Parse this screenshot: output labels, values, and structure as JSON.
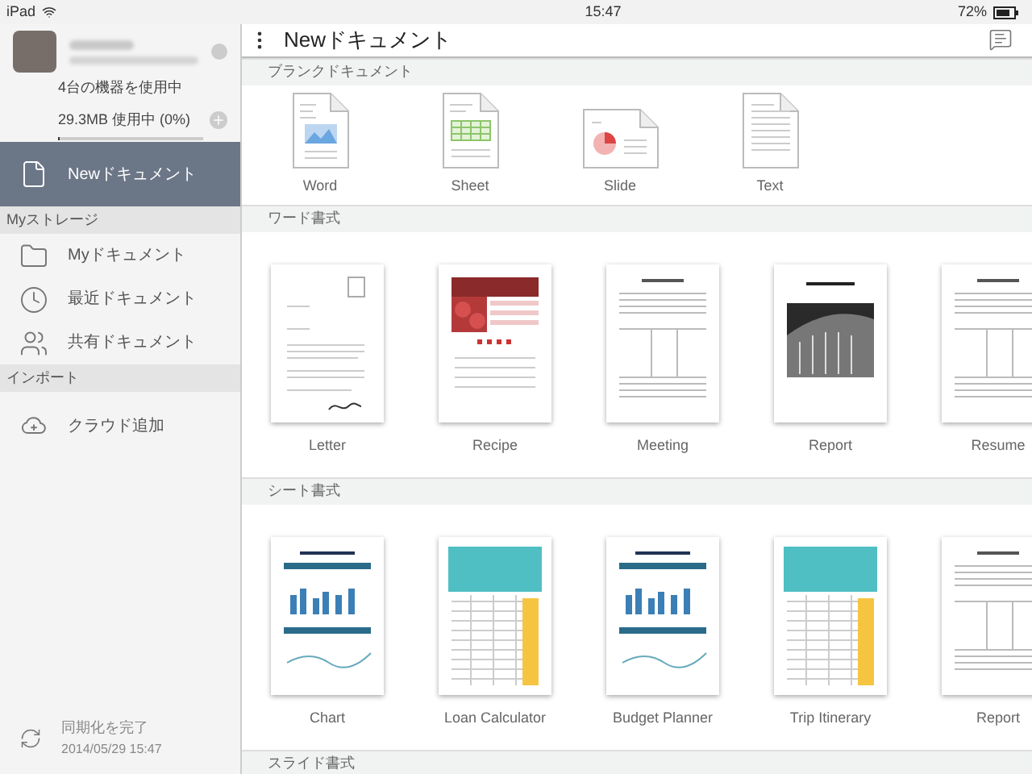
{
  "status_bar": {
    "device": "iPad",
    "time": "15:47",
    "battery": "72%"
  },
  "sidebar": {
    "account": {
      "devices": "4台の機器を使用中",
      "usage": "29.3MB 使用中 (0%)",
      "level": 0.01
    },
    "items": [
      {
        "kind": "item",
        "label": "Newドキュメント",
        "selected": true
      },
      {
        "kind": "section",
        "label": "Myストレージ"
      },
      {
        "kind": "item",
        "label": "Myドキュメント",
        "selected": false
      },
      {
        "kind": "item",
        "label": "最近ドキュメント",
        "selected": false
      },
      {
        "kind": "item",
        "label": "共有ドキュメント",
        "selected": false
      },
      {
        "kind": "section",
        "label": "インポート"
      },
      {
        "kind": "item",
        "label": "クラウド追加",
        "selected": false
      }
    ],
    "sync": {
      "label": "同期化を完了",
      "time": "2014/05/29 15:47"
    }
  },
  "header": {
    "title": "Newドキュメント"
  },
  "sections": [
    {
      "title": "ブランクドキュメント",
      "kind": "blank",
      "items": [
        {
          "label": "Word",
          "kind": "word"
        },
        {
          "label": "Sheet",
          "kind": "sheet"
        },
        {
          "label": "Slide",
          "kind": "slide"
        },
        {
          "label": "Text",
          "kind": "text"
        }
      ]
    },
    {
      "title": "ワード書式",
      "kind": "template",
      "items": [
        {
          "label": "Letter",
          "kind": "letter"
        },
        {
          "label": "Recipe",
          "kind": "recipe"
        },
        {
          "label": "Meeting",
          "kind": "form"
        },
        {
          "label": "Report",
          "kind": "photo"
        },
        {
          "label": "Resume",
          "kind": "form"
        }
      ]
    },
    {
      "title": "シート書式",
      "kind": "template",
      "items": [
        {
          "label": "Chart",
          "kind": "chart"
        },
        {
          "label": "Loan Calculator",
          "kind": "table"
        },
        {
          "label": "Budget Planner",
          "kind": "chart"
        },
        {
          "label": "Trip Itinerary",
          "kind": "table"
        },
        {
          "label": "Report",
          "kind": "form"
        }
      ]
    },
    {
      "title": "スライド書式",
      "kind": "header_only"
    }
  ]
}
